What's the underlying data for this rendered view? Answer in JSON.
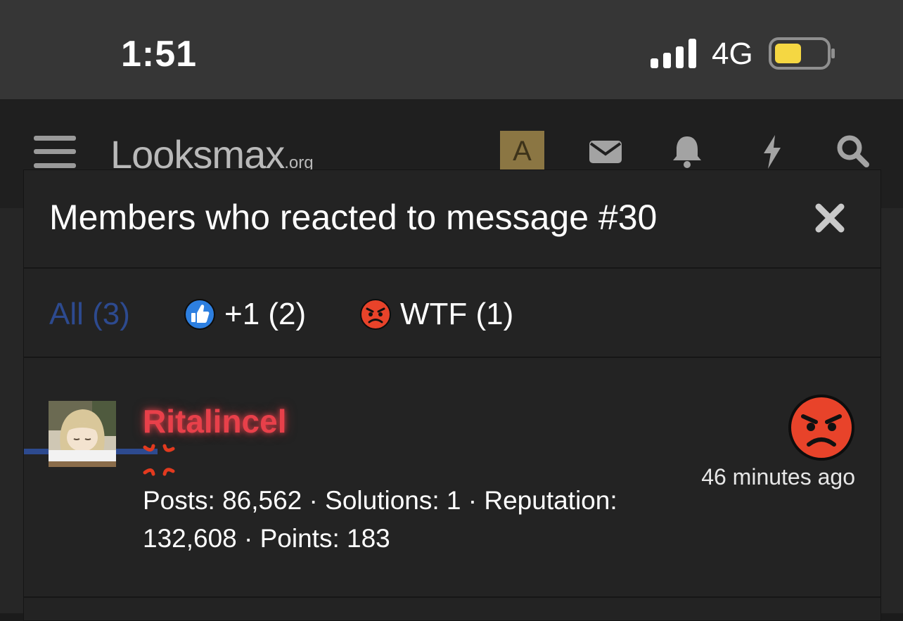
{
  "status_bar": {
    "time": "1:51",
    "network": "4G"
  },
  "header": {
    "logo_main": "Looksmax",
    "logo_suffix": ".org",
    "avatar_letter": "A",
    "icons": [
      "menu-icon",
      "envelope-icon",
      "bell-icon",
      "bolt-icon",
      "search-icon"
    ]
  },
  "modal": {
    "title": "Members who reacted to message #30",
    "tabs": [
      {
        "label": "All (3)",
        "active": true
      },
      {
        "label": "+1 (2)",
        "icon": "thumbs-up-icon"
      },
      {
        "label": "WTF (1)",
        "icon": "angry-face-icon"
      }
    ],
    "members": [
      {
        "name": "Ritalincel",
        "stats_line1": "Posts: 86,562 · Solutions: 1 · Reputation:",
        "stats_line2": "132,608 · Points: 183",
        "time": "46 minutes ago",
        "reaction": "angry-face-icon"
      }
    ]
  },
  "colors": {
    "accent": "#2d4a8f",
    "username": "#e8404a",
    "battery": "#f5d742"
  }
}
